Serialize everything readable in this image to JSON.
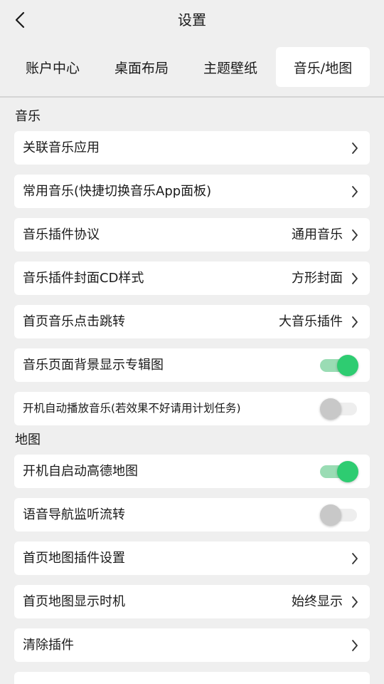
{
  "header": {
    "title": "设置",
    "back_icon": "chevron-left-icon"
  },
  "tabs": [
    {
      "label": "账户中心",
      "active": false
    },
    {
      "label": "桌面布局",
      "active": false
    },
    {
      "label": "主题壁纸",
      "active": false
    },
    {
      "label": "音乐/地图",
      "active": true
    }
  ],
  "music_section": {
    "title": "音乐",
    "items": [
      {
        "label": "关联音乐应用",
        "value": "",
        "control": "chevron"
      },
      {
        "label": "常用音乐(快捷切换音乐App面板)",
        "value": "",
        "control": "chevron"
      },
      {
        "label": "音乐插件协议",
        "value": "通用音乐",
        "control": "chevron"
      },
      {
        "label": "音乐插件封面CD样式",
        "value": "方形封面",
        "control": "chevron"
      },
      {
        "label": "首页音乐点击跳转",
        "value": "大音乐插件",
        "control": "chevron"
      },
      {
        "label": "音乐页面背景显示专辑图",
        "value": "",
        "control": "toggle",
        "checked": true
      },
      {
        "label": "开机自动播放音乐(若效果不好请用计划任务)",
        "value": "",
        "control": "toggle",
        "checked": false
      }
    ]
  },
  "map_section": {
    "title": "地图",
    "items": [
      {
        "label": "开机自启动高德地图",
        "value": "",
        "control": "toggle",
        "checked": true
      },
      {
        "label": "语音导航监听流转",
        "value": "",
        "control": "toggle",
        "checked": false
      },
      {
        "label": "首页地图插件设置",
        "value": "",
        "control": "chevron"
      },
      {
        "label": "首页地图显示时机",
        "value": "始终显示",
        "control": "chevron"
      },
      {
        "label": "清除插件",
        "value": "",
        "control": "chevron"
      }
    ]
  },
  "colors": {
    "background": "#efefef",
    "card": "#ffffff",
    "toggle_on": "#2ecc71",
    "toggle_on_track": "#9adcb4",
    "toggle_off": "#c8c8c8"
  }
}
